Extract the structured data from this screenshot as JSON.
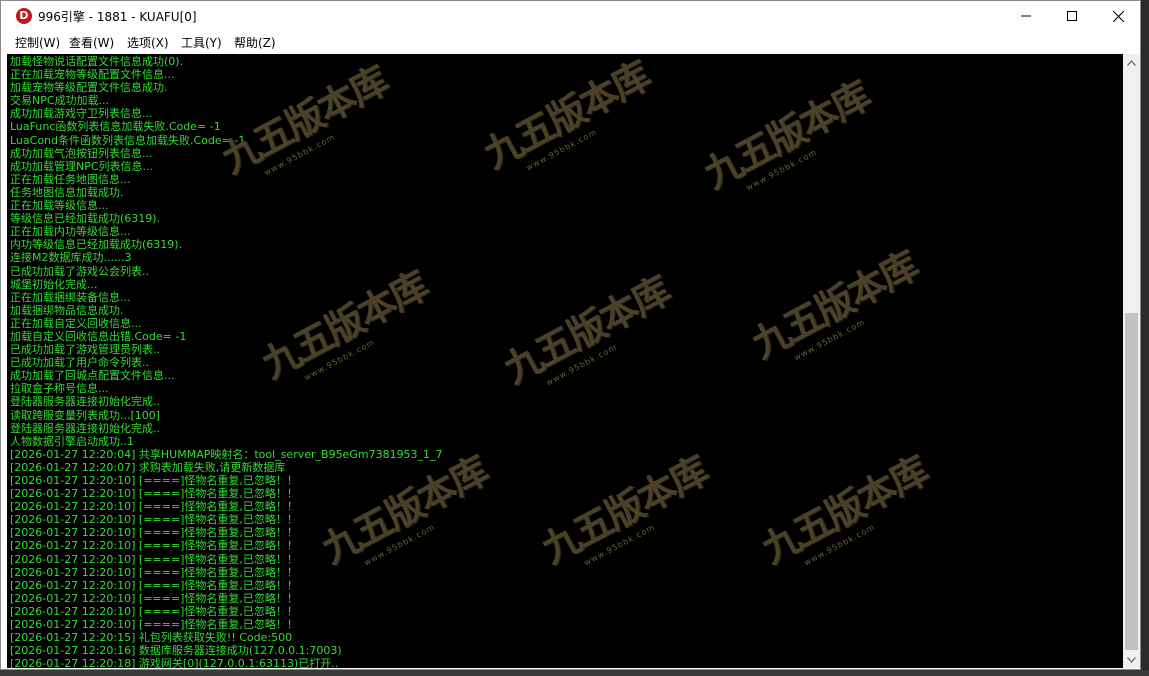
{
  "window": {
    "title": "996引擎 - 1881 - KUAFU[0]",
    "app_icon_letter": "D",
    "controls": [
      "minimize-icon",
      "maximize-icon",
      "close-icon"
    ]
  },
  "menu": [
    {
      "label": "控制(W)"
    },
    {
      "label": "查看(W)"
    },
    {
      "label": "选项(X)"
    },
    {
      "label": "工具(Y)"
    },
    {
      "label": "帮助(Z)"
    }
  ],
  "log": [
    "加载怪物说话配置文件信息成功(0).",
    "正在加载宠物等级配置文件信息...",
    "加载宠物等级配置文件信息成功.",
    "交易NPC成功加载...",
    "成功加载游戏守卫列表信息...",
    "LuaFunc函数列表信息加载失败.Code= -1",
    "LuaCond条件函数列表信息加载失败.Code= -1",
    "成功加载气泡按钮列表信息...",
    "成功加载管理NPC列表信息...",
    "正在加载任务地图信息...",
    "任务地图信息加载成功.",
    "正在加载等级信息...",
    "等级信息已经加载成功(6319).",
    "正在加载内功等级信息...",
    "内功等级信息已经加载成功(6319).",
    "连接M2数据库成功......3",
    "已成功加载了游戏公会列表..",
    "城堡初始化完成...",
    "正在加载捆绑装备信息...",
    "加载捆绑物品信息成功.",
    "正在加载自定义回收信息...",
    "加载自定义回收信息出错.Code= -1",
    "已成功加载了游戏管理员列表..",
    "已成功加载了用户命令列表..",
    "成功加载了回城点配置文件信息...",
    "拉取盒子称号信息...",
    "登陆器服务器连接初始化完成..",
    "读取跨服变量列表成功...[100]",
    "登陆器服务器连接初始化完成..",
    "人物数据引擎启动成功..1",
    "[2026-01-27 12:20:04] 共享HUMMAP映射名：tool_server_B95eGm7381953_1_7",
    "[2026-01-27 12:20:07] 求购表加载失败,请更新数据库",
    "[2026-01-27 12:20:10] [====]怪物名重复,已忽略！！",
    "[2026-01-27 12:20:10] [====]怪物名重复,已忽略！！",
    "[2026-01-27 12:20:10] [====]怪物名重复,已忽略！！",
    "[2026-01-27 12:20:10] [====]怪物名重复,已忽略！！",
    "[2026-01-27 12:20:10] [====]怪物名重复,已忽略！！",
    "[2026-01-27 12:20:10] [====]怪物名重复,已忽略！！",
    "[2026-01-27 12:20:10] [====]怪物名重复,已忽略！！",
    "[2026-01-27 12:20:10] [====]怪物名重复,已忽略！！",
    "[2026-01-27 12:20:10] [====]怪物名重复,已忽略！！",
    "[2026-01-27 12:20:10] [====]怪物名重复,已忽略！！",
    "[2026-01-27 12:20:10] [====]怪物名重复,已忽略！！",
    "[2026-01-27 12:20:10] [====]怪物名重复,已忽略！！",
    "[2026-01-27 12:20:15] 礼包列表获取失败!! Code:500",
    "[2026-01-27 12:20:16] 数据库服务器连接成功(127.0.0.1:7003)",
    "[2026-01-27 12:20:18] 游戏网关[0](127.0.0.1:63113)已打开.."
  ],
  "watermark": {
    "text": "九五版本库",
    "subtext": "www.95bbk.com"
  },
  "colors": {
    "console_bg": "#000000",
    "console_text": "#33dd33",
    "watermark": "#4b4128",
    "app_icon": "#c0171b"
  }
}
